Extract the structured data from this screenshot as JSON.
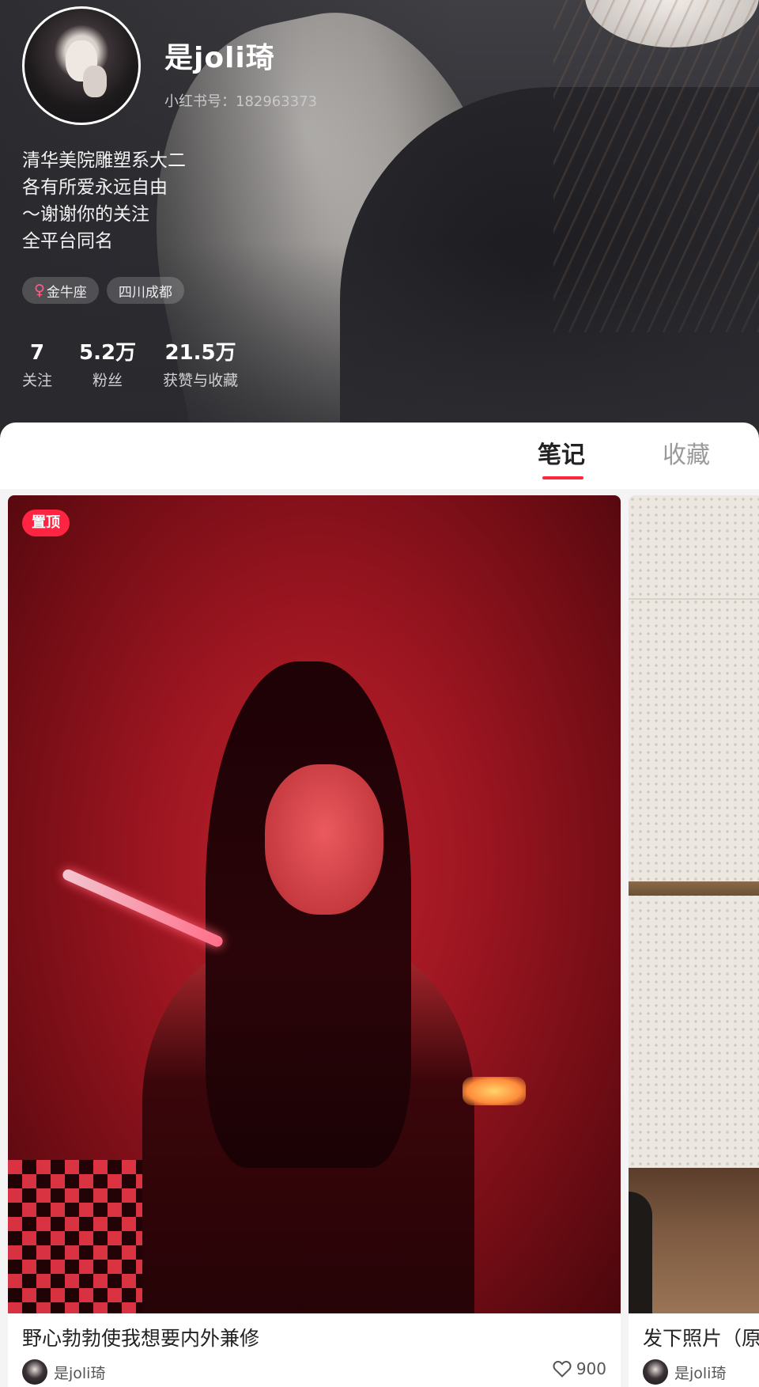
{
  "profile": {
    "name": "是joli琦",
    "xhs_id_label": "小红书号：",
    "xhs_id": "182963373",
    "bio": [
      "清华美院雕塑系大二",
      "各有所爱永远自由",
      "～谢谢你的关注",
      "全平台同名"
    ],
    "tags": [
      {
        "icon": "female-icon",
        "label": "金牛座"
      },
      {
        "label": "四川成都"
      }
    ],
    "stats": [
      {
        "value": "7",
        "label": "关注"
      },
      {
        "value": "5.2万",
        "label": "粉丝"
      },
      {
        "value": "21.5万",
        "label": "获赞与收藏"
      }
    ]
  },
  "tabs": {
    "notes": "笔记",
    "collections": "收藏",
    "active": "notes",
    "accent_color": "#ff2442"
  },
  "notes": [
    {
      "pinned": true,
      "pin_label": "置顶",
      "title": "野心勃勃使我想要内外兼修",
      "author": "是joli琦",
      "likes": "900"
    },
    {
      "pinned": false,
      "title": "发下照片（原",
      "author": "是joli琦",
      "likes": ""
    }
  ]
}
